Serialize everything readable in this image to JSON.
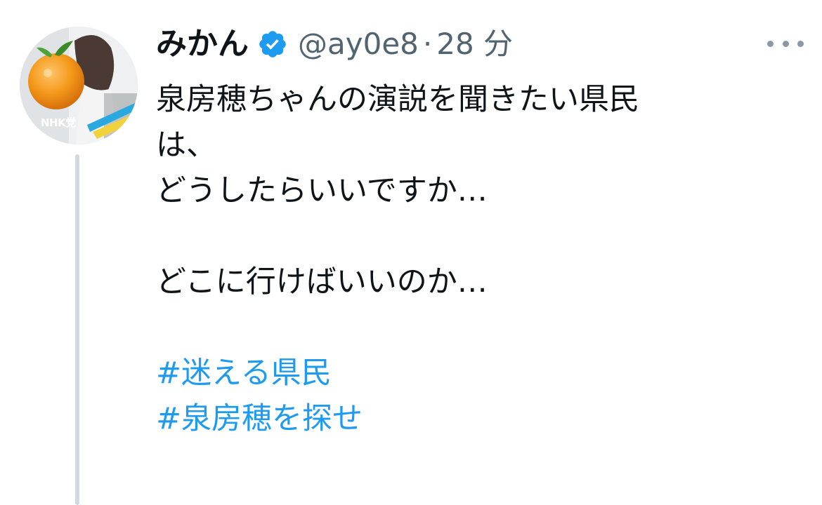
{
  "user": {
    "display_name": "みかん",
    "handle": "@ay0e8",
    "separator": "·",
    "timestamp": "28 分",
    "verified": true,
    "avatar_badge": "NHK党"
  },
  "tweet": {
    "lines": [
      "泉房穂ちゃんの演説を聞きたい県民",
      "は、",
      "どうしたらいいですか…",
      "",
      "どこに行けばいいのか…",
      ""
    ],
    "hashtags": [
      "#迷える県民",
      "#泉房穂を探せ"
    ]
  },
  "icons": {
    "verified": "verified-badge-icon",
    "more": "more-horizontal-icon"
  },
  "colors": {
    "text": "#0f1419",
    "secondary": "#536471",
    "link": "#1d9bf0",
    "verified": "#1d9bf0",
    "thread_line": "#cfd9de"
  }
}
